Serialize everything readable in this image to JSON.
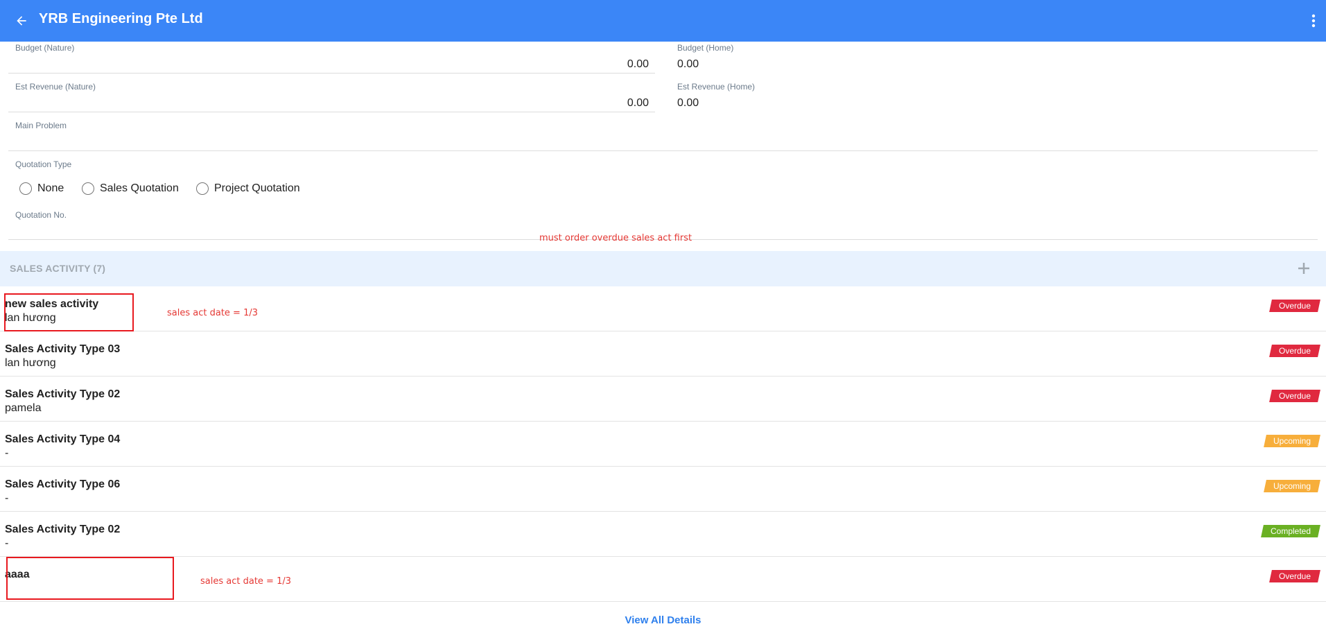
{
  "header": {
    "title": "YRB Engineering Pte Ltd",
    "back_icon": "arrow-left-icon",
    "more_icon": "more-vertical-icon"
  },
  "form": {
    "budget_nature": {
      "label": "Budget (Nature)",
      "value": "0.00"
    },
    "budget_home": {
      "label": "Budget (Home)",
      "value": "0.00"
    },
    "est_revenue_nature": {
      "label": "Est Revenue (Nature)",
      "value": "0.00"
    },
    "est_revenue_home": {
      "label": "Est Revenue (Home)",
      "value": "0.00"
    },
    "main_problem": {
      "label": "Main Problem",
      "value": ""
    },
    "quotation_type": {
      "label": "Quotation Type",
      "options": [
        "None",
        "Sales Quotation",
        "Project Quotation"
      ]
    },
    "quotation_no": {
      "label": "Quotation No.",
      "value": ""
    }
  },
  "annotations": {
    "order_note": "must order overdue sales act first",
    "date_note_1": "sales act date = 1/3",
    "date_note_2": "sales act date = 1/3"
  },
  "sales_activity": {
    "title": "SALES ACTIVITY (7)",
    "items": [
      {
        "name": "new sales activity",
        "person": "lan hương",
        "status": "Overdue"
      },
      {
        "name": "Sales Activity Type 03",
        "person": "lan hương",
        "status": "Overdue"
      },
      {
        "name": "Sales Activity Type 02",
        "person": "pamela",
        "status": "Overdue"
      },
      {
        "name": "Sales Activity Type 04",
        "person": "-",
        "status": "Upcoming"
      },
      {
        "name": "Sales Activity Type 06",
        "person": "-",
        "status": "Upcoming"
      },
      {
        "name": "Sales Activity Type 02",
        "person": "-",
        "status": "Completed"
      },
      {
        "name": "aaaa",
        "person": "",
        "status": "Overdue"
      }
    ],
    "view_all": "View All Details"
  },
  "colors": {
    "header": "#3b86f7",
    "overdue": "#e0293f",
    "upcoming": "#f7ae3b",
    "completed": "#6ab023",
    "link": "#2f80ed"
  }
}
